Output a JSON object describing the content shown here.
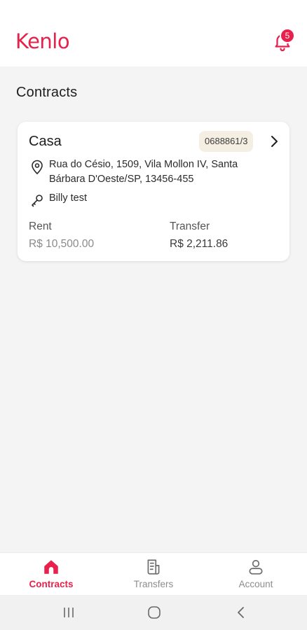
{
  "header": {
    "logo": "Kenlo",
    "notification_count": "5"
  },
  "page": {
    "title": "Contracts"
  },
  "contract": {
    "name": "Casa",
    "code": "0688861/3",
    "address": "Rua do Césio, 1509, Vila Mollon IV, Santa Bárbara D'Oeste/SP, 13456-455",
    "tenant": "Billy test",
    "rent_label": "Rent",
    "rent_value": "R$ 10,500.00",
    "transfer_label": "Transfer",
    "transfer_value": "R$ 2,211.86"
  },
  "nav": {
    "items": [
      {
        "label": "Contracts",
        "icon": "home-icon",
        "active": true
      },
      {
        "label": "Transfers",
        "icon": "document-icon",
        "active": false
      },
      {
        "label": "Account",
        "icon": "user-icon",
        "active": false
      }
    ]
  },
  "colors": {
    "accent": "#e8204c",
    "badge_bg": "#f4efe2"
  }
}
